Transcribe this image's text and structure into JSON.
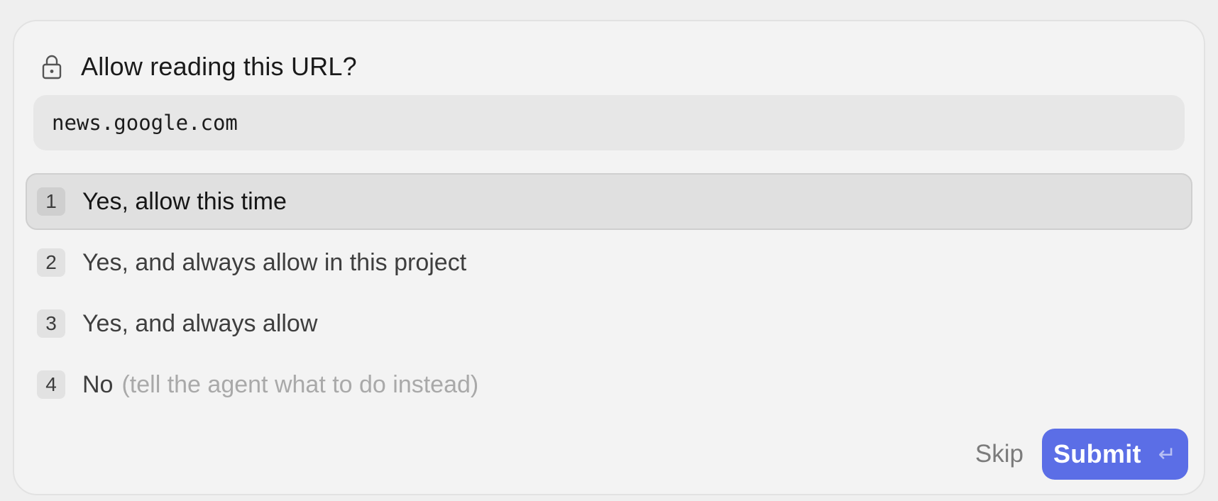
{
  "dialog": {
    "title": "Allow reading this URL?",
    "url": "news.google.com"
  },
  "options": [
    {
      "number": "1",
      "label": "Yes, allow this time",
      "hint": "",
      "selected": true
    },
    {
      "number": "2",
      "label": "Yes, and always allow in this project",
      "hint": "",
      "selected": false
    },
    {
      "number": "3",
      "label": "Yes, and always allow",
      "hint": "",
      "selected": false
    },
    {
      "number": "4",
      "label": "No",
      "hint": "(tell the agent what to do instead)",
      "selected": false
    }
  ],
  "footer": {
    "skip_label": "Skip",
    "submit_label": "Submit",
    "submit_icon": "enter-key-icon",
    "submit_icon_glyph": "↵"
  },
  "colors": {
    "accent": "#5b6ee6",
    "selected_bg": "#e0e0e0",
    "card_bg": "#f3f3f3"
  },
  "icons": {
    "header": "lock-icon"
  }
}
